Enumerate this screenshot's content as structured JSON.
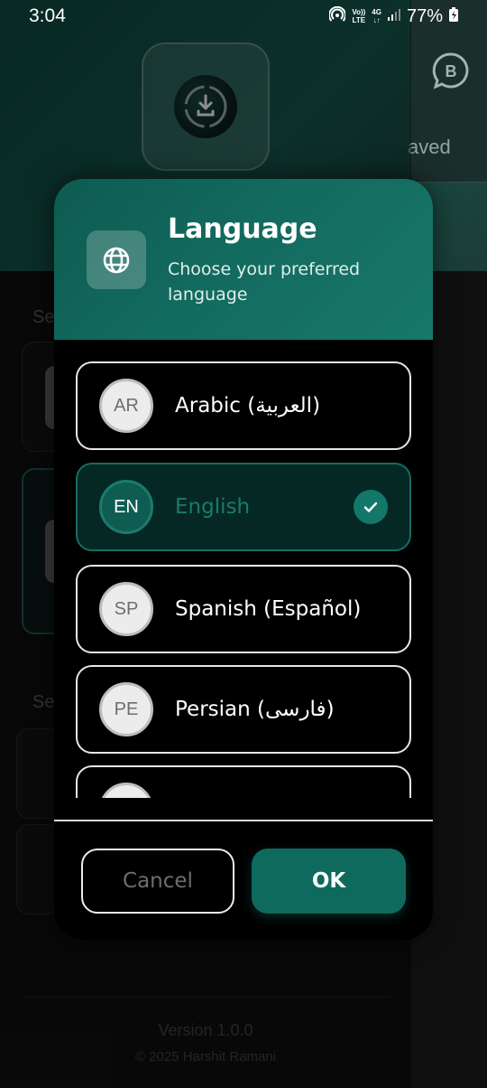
{
  "status_bar": {
    "time": "3:04",
    "volte_top": "Vo))",
    "volte_bottom": "LTE",
    "network_top": "4G",
    "network_bottom": "↓↑",
    "battery": "77%"
  },
  "background": {
    "tab_fragment": "aved",
    "section_fragment_1": "Se",
    "section_fragment_2": "Se",
    "version": "Version 1.0.0",
    "copyright": "© 2025 Harshit Ramani",
    "accent": "#0e6a5d"
  },
  "dialog": {
    "title": "Language",
    "subtitle": "Choose your preferred language",
    "icon": "globe-icon",
    "languages": [
      {
        "code": "AR",
        "name": "Arabic (العربية)",
        "selected": false
      },
      {
        "code": "EN",
        "name": "English",
        "selected": true
      },
      {
        "code": "SP",
        "name": "Spanish (Español)",
        "selected": false
      },
      {
        "code": "PE",
        "name": "Persian (فارسی)",
        "selected": false
      }
    ],
    "cancel_label": "Cancel",
    "ok_label": "OK"
  }
}
